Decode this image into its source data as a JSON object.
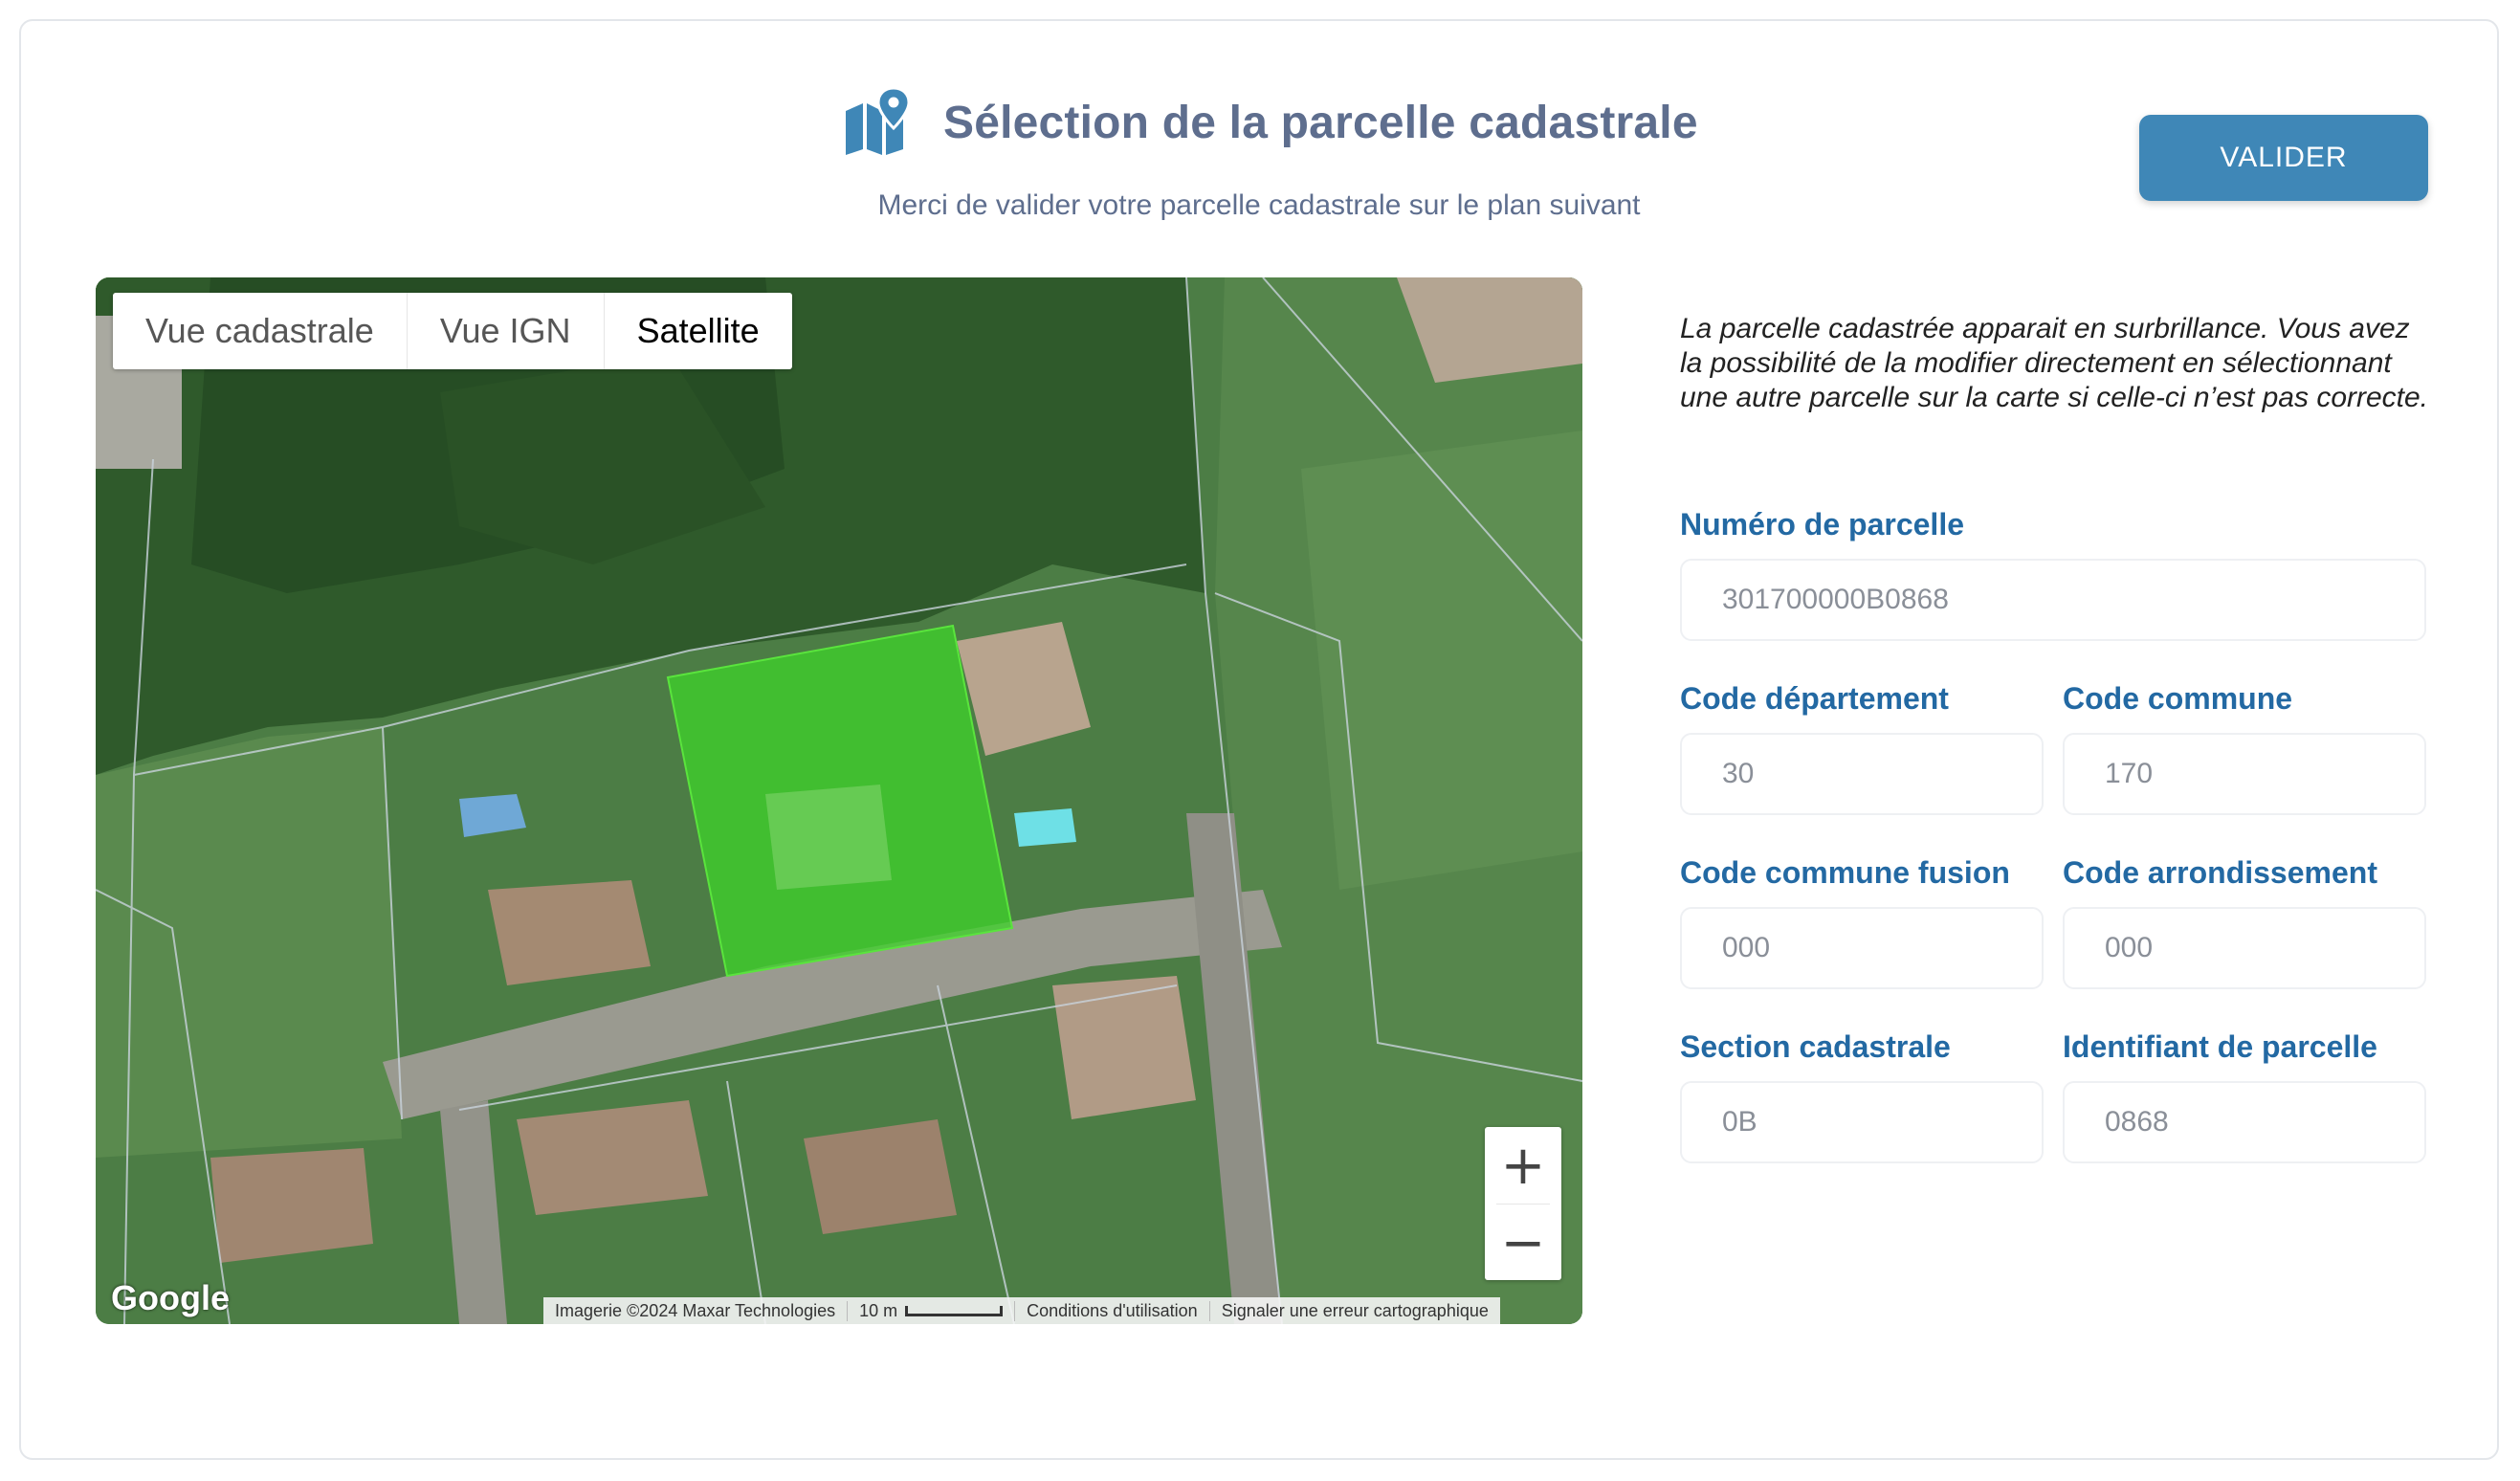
{
  "header": {
    "title": "Sélection de la parcelle cadastrale",
    "subtitle": "Merci de valider votre parcelle cadastrale sur le plan suivant",
    "valider_label": "VALIDER"
  },
  "map": {
    "types": [
      "Vue cadastrale",
      "Vue IGN",
      "Satellite"
    ],
    "active_type": "Satellite",
    "zoom_in": "+",
    "zoom_out": "−",
    "google": "Google",
    "attribution": {
      "imagery": "Imagerie ©2024 Maxar Technologies",
      "scale": "10 m",
      "terms": "Conditions d'utilisation",
      "report": "Signaler une erreur cartographique"
    },
    "highlight_color": "#3fd12a"
  },
  "form": {
    "description": "La parcelle cadastrée apparait en surbrillance. Vous avez la possibilité de la modifier directement en sélectionnant une autre parcelle sur la carte si celle-ci n’est pas correcte.",
    "numero_label": "Numéro de parcelle",
    "numero_value": "301700000B0868",
    "departement_label": "Code département",
    "departement_value": "30",
    "commune_label": "Code commune",
    "commune_value": "170",
    "commune_fusion_label": "Code commune fusion",
    "commune_fusion_value": "000",
    "arrondissement_label": "Code arrondissement",
    "arrondissement_value": "000",
    "section_label": "Section cadastrale",
    "section_value": "0B",
    "identifiant_label": "Identifiant de parcelle",
    "identifiant_value": "0868"
  },
  "colors": {
    "accent": "#3f87b7",
    "label": "#2369a3",
    "title": "#5e6e8e"
  }
}
